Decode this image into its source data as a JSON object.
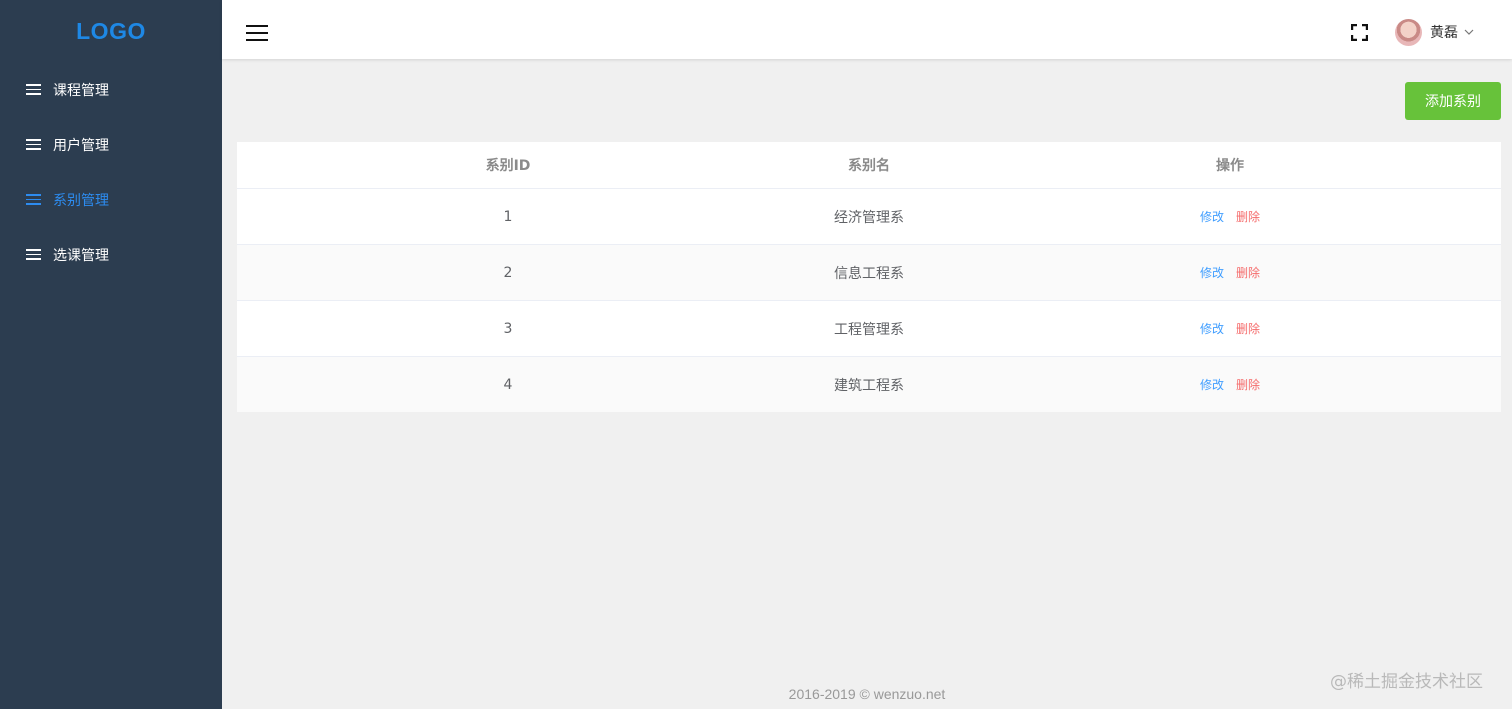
{
  "sidebar": {
    "logo": "LOGO",
    "items": [
      {
        "label": "课程管理",
        "icon": "menu-lines-icon",
        "active": false
      },
      {
        "label": "用户管理",
        "icon": "menu-lines-icon",
        "active": false
      },
      {
        "label": "系别管理",
        "icon": "menu-lines-icon",
        "active": true
      },
      {
        "label": "选课管理",
        "icon": "menu-lines-icon",
        "active": false
      }
    ],
    "colors": {
      "background": "#2c3d50",
      "active": "#2d8cf0",
      "logo": "#1e88e5"
    }
  },
  "header": {
    "menu_toggle_icon": "hamburger-icon",
    "fullscreen_icon": "fullscreen-icon",
    "user": {
      "name": "黄磊",
      "dropdown_icon": "chevron-down-icon"
    }
  },
  "toolbar": {
    "add_label": "添加系别",
    "add_color": "#67c23a"
  },
  "table": {
    "columns": [
      "系别ID",
      "系别名",
      "操作"
    ],
    "rows": [
      {
        "id": "1",
        "name": "经济管理系",
        "edit": "修改",
        "delete": "删除"
      },
      {
        "id": "2",
        "name": "信息工程系",
        "edit": "修改",
        "delete": "删除"
      },
      {
        "id": "3",
        "name": "工程管理系",
        "edit": "修改",
        "delete": "删除"
      },
      {
        "id": "4",
        "name": "建筑工程系",
        "edit": "修改",
        "delete": "删除"
      }
    ]
  },
  "footer": {
    "copyright": "2016-2019 © wenzuo.net",
    "watermark": "@稀土掘金技术社区"
  }
}
